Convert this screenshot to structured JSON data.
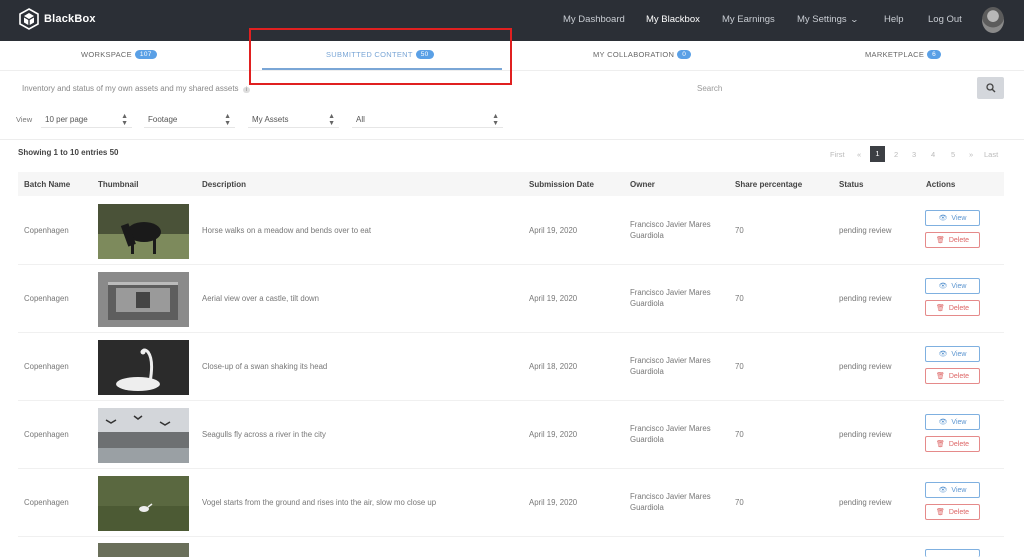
{
  "brand": {
    "name": "BlackBox"
  },
  "nav": {
    "items": [
      {
        "label": "My Dashboard"
      },
      {
        "label": "My Blackbox"
      },
      {
        "label": "My Earnings"
      },
      {
        "label": "My Settings"
      },
      {
        "label": "Help"
      },
      {
        "label": "Log Out"
      }
    ],
    "active": "My Blackbox"
  },
  "tabs": [
    {
      "label": "WORKSPACE",
      "badge": "107"
    },
    {
      "label": "SUBMITTED CONTENT",
      "badge": "50"
    },
    {
      "label": "MY COLLABORATION",
      "badge": "0"
    },
    {
      "label": "MARKETPLACE",
      "badge": "6"
    }
  ],
  "intro": {
    "text": "Inventory and status of my own assets and my shared assets",
    "badge": "i"
  },
  "search": {
    "placeholder": "Search",
    "icon": "search-icon"
  },
  "filters": {
    "view_label": "View",
    "per_page": "10 per page",
    "type": "Footage",
    "scope": "My Assets",
    "status": "All"
  },
  "showing": "Showing 1 to 10 entries 50",
  "pagination": {
    "first": "First",
    "prev": "«",
    "pages": [
      "1",
      "2",
      "3",
      "4",
      "5"
    ],
    "next": "»",
    "last": "Last",
    "current": "1"
  },
  "table": {
    "headers": [
      "Batch Name",
      "Thumbnail",
      "Description",
      "Submission Date",
      "Owner",
      "Share percentage",
      "Status",
      "Actions"
    ],
    "rows": [
      {
        "batch": "Copenhagen",
        "description": "Horse walks on a meadow and bends over to eat",
        "date": "April 19, 2020",
        "owner": "Francisco Javier Mares Guardiola",
        "share": "70",
        "status": "pending review"
      },
      {
        "batch": "Copenhagen",
        "description": "Aerial view over a castle, tilt down",
        "date": "April 19, 2020",
        "owner": "Francisco Javier Mares Guardiola",
        "share": "70",
        "status": "pending review"
      },
      {
        "batch": "Copenhagen",
        "description": "Close-up of a swan shaking its head",
        "date": "April 18, 2020",
        "owner": "Francisco Javier Mares Guardiola",
        "share": "70",
        "status": "pending review"
      },
      {
        "batch": "Copenhagen",
        "description": "Seagulls fly across a river in the city",
        "date": "April 19, 2020",
        "owner": "Francisco Javier Mares Guardiola",
        "share": "70",
        "status": "pending review"
      },
      {
        "batch": "Copenhagen",
        "description": "Vogel starts from the ground and rises into the air, slow mo close up",
        "date": "April 19, 2020",
        "owner": "Francisco Javier Mares Guardiola",
        "share": "70",
        "status": "pending review"
      }
    ],
    "actions": {
      "view": "View",
      "delete": "Delete"
    }
  },
  "colors": {
    "nav_bg": "#2b2f36",
    "accent": "#5aa0e6",
    "highlight": "#e02020",
    "delete": "#dd6666"
  }
}
